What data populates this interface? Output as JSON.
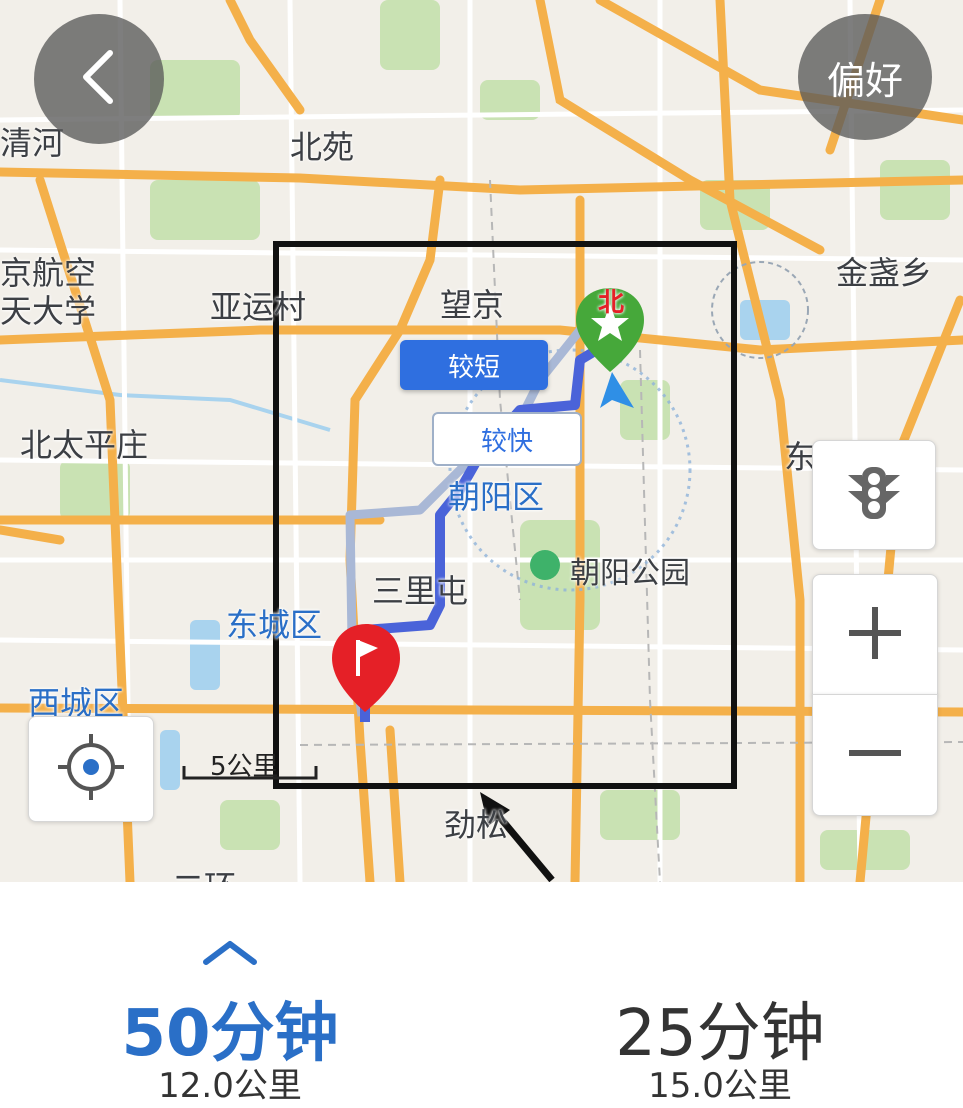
{
  "colors": {
    "accent": "#2a6fc7",
    "route_short": "#4a63d9",
    "route_fast": "#a9b8d6",
    "road_major": "#f4b04a",
    "start_pin": "#e52027",
    "end_pin": "#46a83a",
    "park": "#c9e2b3",
    "water": "#a9d3ee"
  },
  "map": {
    "labels": {
      "qinghe": "清河",
      "beiyuan": "北苑",
      "hangkong_1": "京航空",
      "hangkong_2": "天大学",
      "yayuncun": "亚运村",
      "wangjing": "望京",
      "jinzhan": "金盏乡",
      "beitaipingzhuang": "北太平庄",
      "chaoyangqu": "朝阳区",
      "chaoyang_park": "朝阳公园",
      "sanlitun": "三里屯",
      "dongchengqu": "东城区",
      "xichengqu": "西城区",
      "jinsong": "劲松",
      "erhuan": "二环",
      "dong_partial": "东",
      "north_marker": "北"
    },
    "scale_label": "5公里",
    "route_tags": {
      "shorter": "较短",
      "faster": "较快"
    }
  },
  "controls": {
    "back_icon": "chevron-left-icon",
    "preferences_label": "偏好",
    "traffic_icon": "traffic-light-icon",
    "zoom_in_icon": "plus-icon",
    "zoom_out_icon": "minus-icon",
    "locate_icon": "locate-icon"
  },
  "routes": [
    {
      "time": "50分钟",
      "distance": "12.0公里",
      "selected": true
    },
    {
      "time": "25分钟",
      "distance": "15.0公里",
      "selected": false
    }
  ],
  "expand_icon": "chevron-up-icon"
}
